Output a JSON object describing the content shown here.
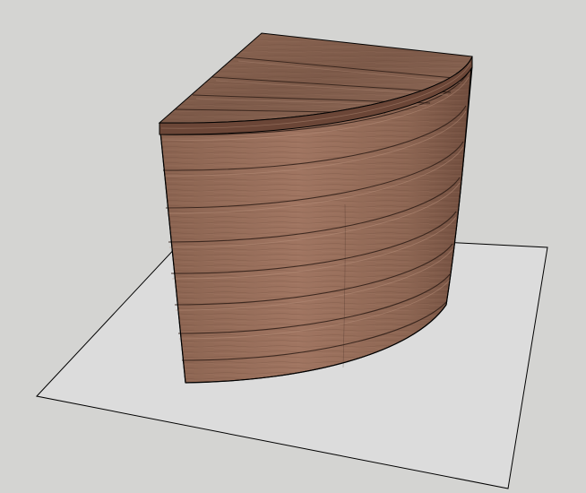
{
  "viewport": {
    "background": "#d4d4d2",
    "ground_plane_fill": "#dcdcdc",
    "edge_color": "#000000"
  },
  "model": {
    "shape": "quarter-round-box",
    "material": "wood-planks",
    "top_plank_count": 5,
    "side_plank_count": 9,
    "wood_light": "#9a6e57",
    "wood_mid": "#7f5948",
    "wood_dark": "#4a3025"
  }
}
